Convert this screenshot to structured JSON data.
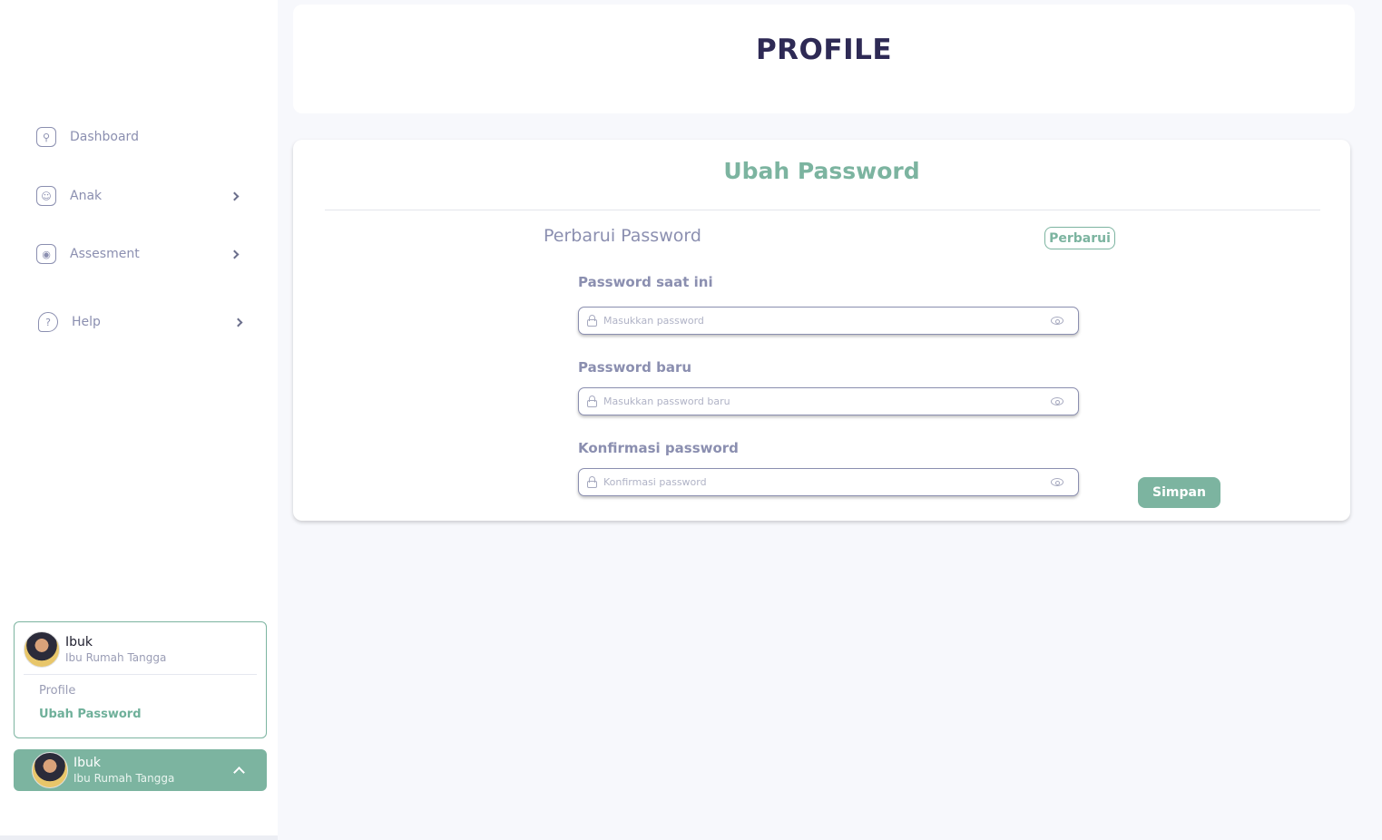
{
  "sidebar": {
    "items": [
      {
        "label": "Dashboard",
        "icon": "dashboard-icon"
      },
      {
        "label": "Anak",
        "icon": "child-face-icon"
      },
      {
        "label": "Assesment",
        "icon": "user-icon"
      },
      {
        "label": "Help",
        "icon": "help-icon"
      }
    ],
    "profile_card": {
      "name": "Ibuk",
      "role": "Ibu Rumah Tangga",
      "links": [
        "Profile",
        "Ubah Password"
      ]
    },
    "user_bar": {
      "name": "Ibuk",
      "role": "Ibu Rumah Tangga"
    }
  },
  "header": {
    "title": "PROFILE"
  },
  "main": {
    "card_title": "Ubah Password",
    "section_title": "Perbarui Password",
    "perbarui_label": "Perbarui",
    "fields": [
      {
        "label": "Password saat ini",
        "placeholder": "Masukkan password"
      },
      {
        "label": "Password baru",
        "placeholder": "Masukkan password baru"
      },
      {
        "label": "Konfirmasi password",
        "placeholder": "Konfirmasi password"
      }
    ],
    "save_label": "Simpan"
  },
  "colors": {
    "accent": "#7cb4a0",
    "title": "#2e2a55",
    "muted": "#8b8fb0",
    "background": "#f7f8fc"
  }
}
